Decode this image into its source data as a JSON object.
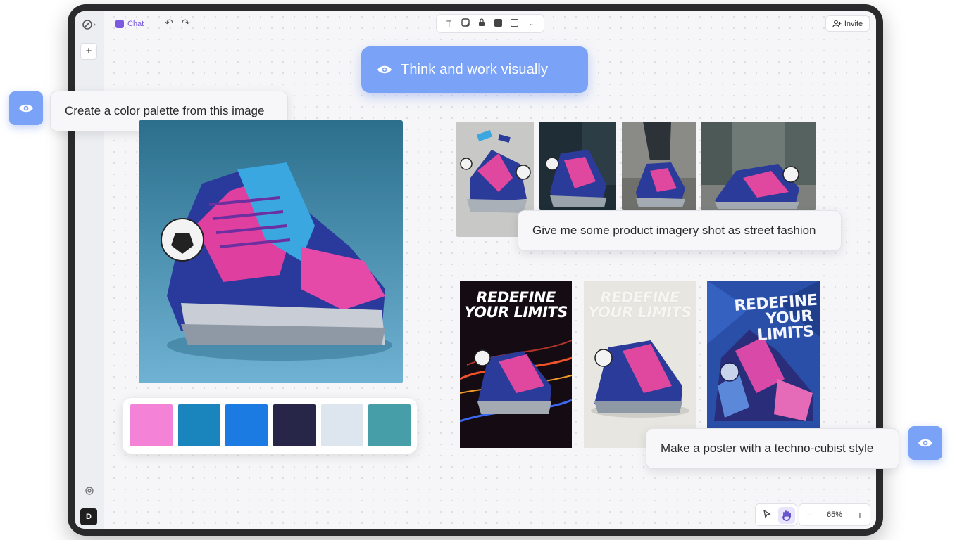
{
  "topbar": {
    "chat_label": "Chat",
    "invite_label": "Invite",
    "tools": [
      "text-tool-icon",
      "sticker-tool-icon",
      "lock-tool-icon",
      "note-tool-icon",
      "shape-tool-icon",
      "chevron-down-icon"
    ]
  },
  "sidebar": {
    "avatar_initial": "D"
  },
  "hero": {
    "text": "Think and work visually"
  },
  "prompts": {
    "palette": "Create a color palette from this image",
    "street": "Give me some product imagery shot as street fashion",
    "poster": "Make a poster with a techno-cubist style"
  },
  "palette_colors": [
    "#f482d6",
    "#1a84bd",
    "#1b7be3",
    "#272649",
    "#dde5ee",
    "#469fa8"
  ],
  "posters": {
    "title_line1": "REDEFINE",
    "title_line2": "YOUR LIMITS",
    "cubist_line1": "REDEFINE",
    "cubist_line2": "YOUR",
    "cubist_line3": "LIMITS"
  },
  "zoom": {
    "level": "65%"
  },
  "colors": {
    "accent": "#7aa2f7",
    "chat": "#7a5ae0"
  }
}
